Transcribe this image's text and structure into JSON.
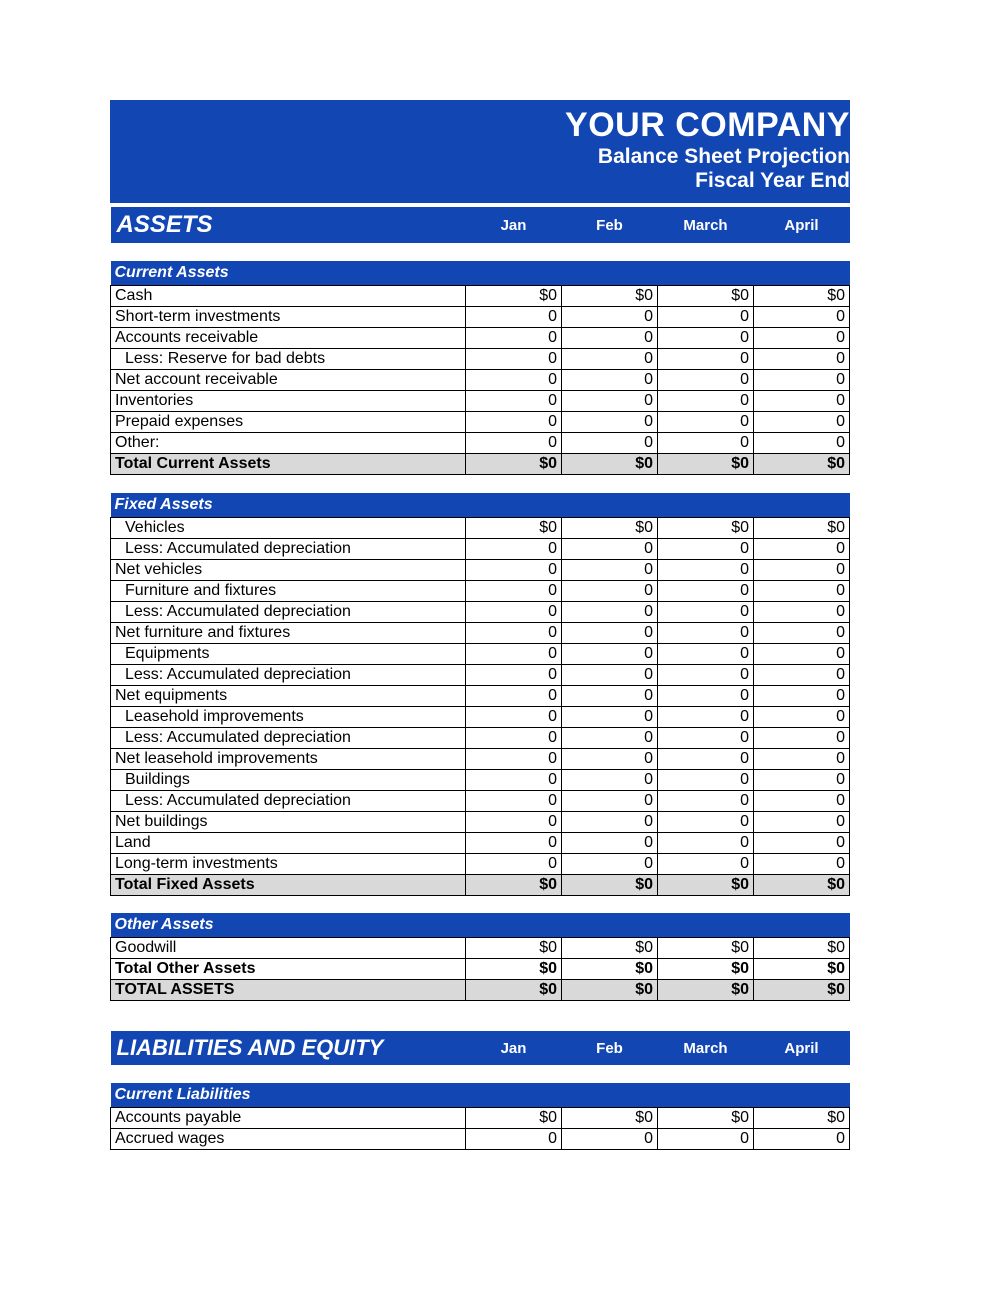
{
  "header": {
    "company": "YOUR COMPANY",
    "line2": "Balance Sheet Projection",
    "line3": "Fiscal Year End"
  },
  "months": [
    "Jan",
    "Feb",
    "March",
    "April"
  ],
  "assets": {
    "title": "ASSETS",
    "current": {
      "title": "Current Assets",
      "rows": [
        {
          "label": "Cash",
          "vals": [
            "$0",
            "$0",
            "$0",
            "$0"
          ],
          "indent": 0
        },
        {
          "label": "Short-term investments",
          "vals": [
            "0",
            "0",
            "0",
            "0"
          ],
          "indent": 0
        },
        {
          "label": "Accounts receivable",
          "vals": [
            "0",
            "0",
            "0",
            "0"
          ],
          "indent": 0
        },
        {
          "label": "Less: Reserve for bad debts",
          "vals": [
            "0",
            "0",
            "0",
            "0"
          ],
          "indent": 1
        },
        {
          "label": "Net account receivable",
          "vals": [
            "0",
            "0",
            "0",
            "0"
          ],
          "indent": 0
        },
        {
          "label": "Inventories",
          "vals": [
            "0",
            "0",
            "0",
            "0"
          ],
          "indent": 0
        },
        {
          "label": "Prepaid expenses",
          "vals": [
            "0",
            "0",
            "0",
            "0"
          ],
          "indent": 0
        },
        {
          "label": "Other:",
          "vals": [
            "0",
            "0",
            "0",
            "0"
          ],
          "indent": 0
        }
      ],
      "total": {
        "label": "Total Current Assets",
        "vals": [
          "$0",
          "$0",
          "$0",
          "$0"
        ]
      }
    },
    "fixed": {
      "title": "Fixed Assets",
      "rows": [
        {
          "label": "Vehicles",
          "vals": [
            "$0",
            "$0",
            "$0",
            "$0"
          ],
          "indent": 1
        },
        {
          "label": "Less: Accumulated depreciation",
          "vals": [
            "0",
            "0",
            "0",
            "0"
          ],
          "indent": 1
        },
        {
          "label": "Net vehicles",
          "vals": [
            "0",
            "0",
            "0",
            "0"
          ],
          "indent": 0
        },
        {
          "label": "Furniture and fixtures",
          "vals": [
            "0",
            "0",
            "0",
            "0"
          ],
          "indent": 1
        },
        {
          "label": "Less: Accumulated depreciation",
          "vals": [
            "0",
            "0",
            "0",
            "0"
          ],
          "indent": 1
        },
        {
          "label": "Net furniture and fixtures",
          "vals": [
            "0",
            "0",
            "0",
            "0"
          ],
          "indent": 0
        },
        {
          "label": "Equipments",
          "vals": [
            "0",
            "0",
            "0",
            "0"
          ],
          "indent": 1
        },
        {
          "label": "Less: Accumulated depreciation",
          "vals": [
            "0",
            "0",
            "0",
            "0"
          ],
          "indent": 1
        },
        {
          "label": "Net equipments",
          "vals": [
            "0",
            "0",
            "0",
            "0"
          ],
          "indent": 0
        },
        {
          "label": "Leasehold improvements",
          "vals": [
            "0",
            "0",
            "0",
            "0"
          ],
          "indent": 1
        },
        {
          "label": "Less: Accumulated depreciation",
          "vals": [
            "0",
            "0",
            "0",
            "0"
          ],
          "indent": 1
        },
        {
          "label": "Net leasehold improvements",
          "vals": [
            "0",
            "0",
            "0",
            "0"
          ],
          "indent": 0
        },
        {
          "label": "Buildings",
          "vals": [
            "0",
            "0",
            "0",
            "0"
          ],
          "indent": 1
        },
        {
          "label": "Less: Accumulated depreciation",
          "vals": [
            "0",
            "0",
            "0",
            "0"
          ],
          "indent": 1
        },
        {
          "label": "Net buildings",
          "vals": [
            "0",
            "0",
            "0",
            "0"
          ],
          "indent": 0
        },
        {
          "label": "Land",
          "vals": [
            "0",
            "0",
            "0",
            "0"
          ],
          "indent": 0
        },
        {
          "label": "Long-term investments",
          "vals": [
            "0",
            "0",
            "0",
            "0"
          ],
          "indent": 0
        }
      ],
      "total": {
        "label": "Total Fixed Assets",
        "vals": [
          "$0",
          "$0",
          "$0",
          "$0"
        ]
      }
    },
    "other": {
      "title": "Other Assets",
      "rows": [
        {
          "label": "Goodwill",
          "vals": [
            "$0",
            "$0",
            "$0",
            "$0"
          ],
          "indent": 0
        }
      ],
      "total": {
        "label": "Total Other Assets",
        "vals": [
          "$0",
          "$0",
          "$0",
          "$0"
        ]
      }
    },
    "grand": {
      "label": "TOTAL ASSETS",
      "vals": [
        "$0",
        "$0",
        "$0",
        "$0"
      ]
    }
  },
  "liab": {
    "title": "LIABILITIES AND EQUITY",
    "current": {
      "title": "Current Liabilities",
      "rows": [
        {
          "label": "Accounts payable",
          "vals": [
            "$0",
            "$0",
            "$0",
            "$0"
          ],
          "indent": 0
        },
        {
          "label": "Accrued wages",
          "vals": [
            "0",
            "0",
            "0",
            "0"
          ],
          "indent": 0
        }
      ]
    }
  }
}
